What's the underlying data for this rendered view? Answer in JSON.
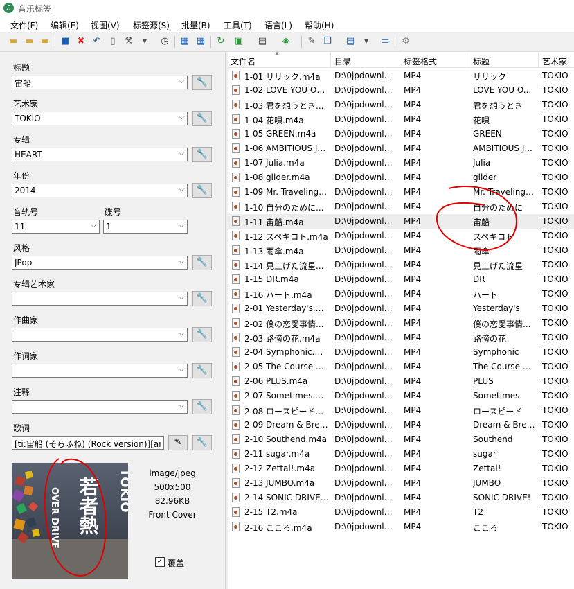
{
  "window": {
    "title": "音乐标签"
  },
  "menu": [
    "文件(F)",
    "编辑(E)",
    "视图(V)",
    "标签源(S)",
    "批量(B)",
    "工具(T)",
    "语言(L)",
    "帮助(H)"
  ],
  "toolbar_icons": [
    "open-folder-icon",
    "add-folder-icon",
    "folders-icon",
    "save-icon",
    "delete-icon",
    "undo-icon",
    "book-icon",
    "wrench-icon",
    "tag-source-icon",
    "history-icon",
    "grid-icon",
    "table-icon",
    "refresh-icon",
    "image-icon",
    "text-icon",
    "edit-tag-icon",
    "tools-icon",
    "copy-icon",
    "export-icon",
    "batch-icon",
    "window-icon",
    "settings-icon"
  ],
  "fields": {
    "title": {
      "label": "标题",
      "value": "宙船"
    },
    "artist": {
      "label": "艺术家",
      "value": "TOKIO"
    },
    "album": {
      "label": "专辑",
      "value": "HEART"
    },
    "year": {
      "label": "年份",
      "value": "2014"
    },
    "track": {
      "label": "音轨号",
      "value": "11"
    },
    "disc": {
      "label": "碟号",
      "value": "1"
    },
    "genre": {
      "label": "风格",
      "value": "JPop"
    },
    "album_artist": {
      "label": "专辑艺术家",
      "value": ""
    },
    "composer": {
      "label": "作曲家",
      "value": ""
    },
    "lyricist": {
      "label": "作词家",
      "value": ""
    },
    "comment": {
      "label": "注释",
      "value": ""
    },
    "lyrics": {
      "label": "歌词",
      "value": "[ti:宙船 (そらふね) (Rock version)][ar"
    }
  },
  "cover": {
    "mime": "image/jpeg",
    "size": "500x500",
    "filesize": "82.96KB",
    "type": "Front Cover",
    "overwrite_label": "覆盖",
    "overwrite_checked": true,
    "art_text_a": "TOKIO",
    "art_text_b": "若者熱",
    "art_text_c": "OVER DRIVE"
  },
  "table": {
    "headers": [
      "文件名",
      "目录",
      "标签格式",
      "标题",
      "艺术家"
    ],
    "selected_index": 10,
    "rows": [
      {
        "file": "1-01 リリック.m4a",
        "dir": "D:\\0jpdownlo...",
        "fmt": "MP4",
        "title": "リリック",
        "artist": "TOKIO"
      },
      {
        "file": "1-02 LOVE YOU ON...",
        "dir": "D:\\0jpdownlo...",
        "fmt": "MP4",
        "title": "LOVE YOU O...",
        "artist": "TOKIO"
      },
      {
        "file": "1-03 君を想うとき...",
        "dir": "D:\\0jpdownlo...",
        "fmt": "MP4",
        "title": "君を想うとき",
        "artist": "TOKIO"
      },
      {
        "file": "1-04 花唄.m4a",
        "dir": "D:\\0jpdownlo...",
        "fmt": "MP4",
        "title": "花唄",
        "artist": "TOKIO"
      },
      {
        "file": "1-05 GREEN.m4a",
        "dir": "D:\\0jpdownlo...",
        "fmt": "MP4",
        "title": "GREEN",
        "artist": "TOKIO"
      },
      {
        "file": "1-06 AMBITIOUS JA...",
        "dir": "D:\\0jpdownlo...",
        "fmt": "MP4",
        "title": "AMBITIOUS J...",
        "artist": "TOKIO"
      },
      {
        "file": "1-07 Julia.m4a",
        "dir": "D:\\0jpdownlo...",
        "fmt": "MP4",
        "title": "Julia",
        "artist": "TOKIO"
      },
      {
        "file": "1-08 glider.m4a",
        "dir": "D:\\0jpdownlo...",
        "fmt": "MP4",
        "title": "glider",
        "artist": "TOKIO"
      },
      {
        "file": "1-09 Mr. Traveling ...",
        "dir": "D:\\0jpdownlo...",
        "fmt": "MP4",
        "title": "Mr. Traveling ...",
        "artist": "TOKIO"
      },
      {
        "file": "1-10 自分のために...",
        "dir": "D:\\0jpdownlo...",
        "fmt": "MP4",
        "title": "自分のために",
        "artist": "TOKIO"
      },
      {
        "file": "1-11 宙船.m4a",
        "dir": "D:\\0jpdownlo...",
        "fmt": "MP4",
        "title": "宙船",
        "artist": "TOKIO"
      },
      {
        "file": "1-12 スペキコト.m4a",
        "dir": "D:\\0jpdownlo...",
        "fmt": "MP4",
        "title": "スペキコト",
        "artist": "TOKIO"
      },
      {
        "file": "1-13 雨傘.m4a",
        "dir": "D:\\0jpdownlo...",
        "fmt": "MP4",
        "title": "雨傘",
        "artist": "TOKIO"
      },
      {
        "file": "1-14 見上げた流星...",
        "dir": "D:\\0jpdownlo...",
        "fmt": "MP4",
        "title": "見上げた流星",
        "artist": "TOKIO"
      },
      {
        "file": "1-15 DR.m4a",
        "dir": "D:\\0jpdownlo...",
        "fmt": "MP4",
        "title": "DR",
        "artist": "TOKIO"
      },
      {
        "file": "1-16 ハート.m4a",
        "dir": "D:\\0jpdownlo...",
        "fmt": "MP4",
        "title": "ハート",
        "artist": "TOKIO"
      },
      {
        "file": "2-01 Yesterday's.m4a",
        "dir": "D:\\0jpdownlo...",
        "fmt": "MP4",
        "title": "Yesterday's",
        "artist": "TOKIO"
      },
      {
        "file": "2-02 僕の恋愛事情...",
        "dir": "D:\\0jpdownlo...",
        "fmt": "MP4",
        "title": "僕の恋愛事情...",
        "artist": "TOKIO"
      },
      {
        "file": "2-03 路傍の花.m4a",
        "dir": "D:\\0jpdownlo...",
        "fmt": "MP4",
        "title": "路傍の花",
        "artist": "TOKIO"
      },
      {
        "file": "2-04 Symphonic.m4a",
        "dir": "D:\\0jpdownlo...",
        "fmt": "MP4",
        "title": "Symphonic",
        "artist": "TOKIO"
      },
      {
        "file": "2-05 The Course of...",
        "dir": "D:\\0jpdownlo...",
        "fmt": "MP4",
        "title": "The Course o...",
        "artist": "TOKIO"
      },
      {
        "file": "2-06 PLUS.m4a",
        "dir": "D:\\0jpdownlo...",
        "fmt": "MP4",
        "title": "PLUS",
        "artist": "TOKIO"
      },
      {
        "file": "2-07 Sometimes.m4a",
        "dir": "D:\\0jpdownlo...",
        "fmt": "MP4",
        "title": "Sometimes",
        "artist": "TOKIO"
      },
      {
        "file": "2-08 ロースピード...",
        "dir": "D:\\0jpdownlo...",
        "fmt": "MP4",
        "title": "ロースピード",
        "artist": "TOKIO"
      },
      {
        "file": "2-09 Dream & Breez...",
        "dir": "D:\\0jpdownlo...",
        "fmt": "MP4",
        "title": "Dream & Breeze",
        "artist": "TOKIO"
      },
      {
        "file": "2-10 Southend.m4a",
        "dir": "D:\\0jpdownlo...",
        "fmt": "MP4",
        "title": "Southend",
        "artist": "TOKIO"
      },
      {
        "file": "2-11 sugar.m4a",
        "dir": "D:\\0jpdownlo...",
        "fmt": "MP4",
        "title": "sugar",
        "artist": "TOKIO"
      },
      {
        "file": "2-12 Zettai!.m4a",
        "dir": "D:\\0jpdownlo...",
        "fmt": "MP4",
        "title": "Zettai!",
        "artist": "TOKIO"
      },
      {
        "file": "2-13 JUMBO.m4a",
        "dir": "D:\\0jpdownlo...",
        "fmt": "MP4",
        "title": "JUMBO",
        "artist": "TOKIO"
      },
      {
        "file": "2-14 SONIC DRIVE!...",
        "dir": "D:\\0jpdownlo...",
        "fmt": "MP4",
        "title": "SONIC DRIVE!",
        "artist": "TOKIO"
      },
      {
        "file": "2-15 T2.m4a",
        "dir": "D:\\0jpdownlo...",
        "fmt": "MP4",
        "title": "T2",
        "artist": "TOKIO"
      },
      {
        "file": "2-16 こころ.m4a",
        "dir": "D:\\0jpdownlo...",
        "fmt": "MP4",
        "title": "こころ",
        "artist": "TOKIO"
      }
    ]
  },
  "colors": {
    "annotation": "#e00000",
    "selected_row": "#ededed"
  }
}
